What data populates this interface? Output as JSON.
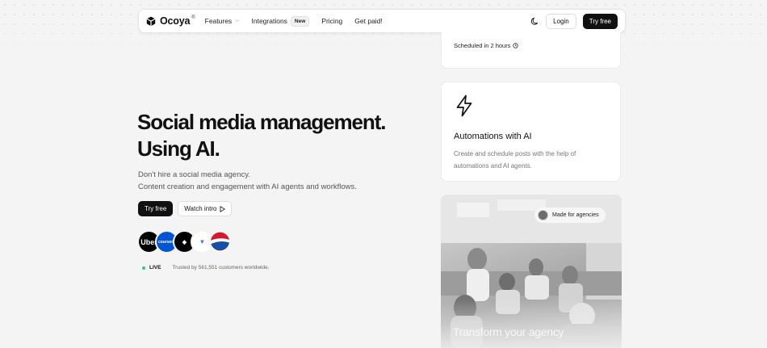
{
  "nav": {
    "brand": "Ocoya",
    "brand_mark": "®",
    "features": "Features",
    "integrations": "Integrations",
    "integrations_badge": "New",
    "pricing": "Pricing",
    "get_paid": "Get paid!",
    "login": "Login",
    "try_free": "Try free"
  },
  "hero": {
    "title_line1": "Social media management.",
    "title_line2": "Using AI.",
    "sub_line1": "Don't hire a social media agency.",
    "sub_line2": "Content creation and engagement with AI agents and workflows.",
    "try_free": "Try free",
    "watch_intro": "Watch intro",
    "logos": [
      {
        "name": "Uber",
        "text": "Uber"
      },
      {
        "name": "Coursera",
        "text": "coursera"
      },
      {
        "name": "Square",
        "text": "◆"
      },
      {
        "name": "Blue app",
        "text": "⩔"
      },
      {
        "name": "Pepsi",
        "text": ""
      }
    ],
    "live_label": "LIVE",
    "trusted_text": "Trusted by 561,551 customers worldwide."
  },
  "cards": {
    "scheduled": "Scheduled in 2 hours",
    "auto_title": "Automations with AI",
    "auto_desc": "Create and schedule posts with the help of automations and AI agents.",
    "agency_pill": "Made for agencies",
    "photo_caption": "Transform your agency"
  },
  "colors": {
    "accent_dark": "#111111",
    "live_green": "#2ecc71"
  }
}
